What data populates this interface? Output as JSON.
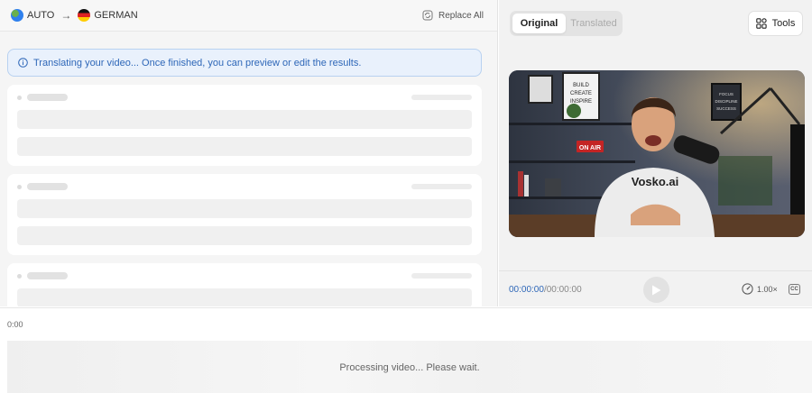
{
  "header": {
    "source_lang": "AUTO",
    "target_lang": "GERMAN",
    "replace_all_label": "Replace All"
  },
  "notice": {
    "text": "Translating your video... Once finished, you can preview or edit the results."
  },
  "preview": {
    "tabs": [
      {
        "label": "Original",
        "active": true
      },
      {
        "label": "Translated",
        "active": false
      }
    ],
    "tools_label": "Tools",
    "video": {
      "poster_texts": [
        "BUILD",
        "CREATE",
        "INSPIRE"
      ],
      "right_poster_texts": [
        "FOCUS",
        "DISCIPLINE",
        "SUCCESS"
      ],
      "on_air": "ON AIR",
      "shirt_logo": "Vosko.ai"
    },
    "player": {
      "current_time": "00:00:00",
      "separator": "/",
      "duration": "00:00:00",
      "speed": "1.00×",
      "cc_label": "CC"
    }
  },
  "timeline": {
    "start_label": "0:00",
    "status": "Processing video... Please wait."
  },
  "colors": {
    "accent": "#2e67b8",
    "notice_bg": "#e9f1fc",
    "notice_border": "#b8d1f0"
  }
}
